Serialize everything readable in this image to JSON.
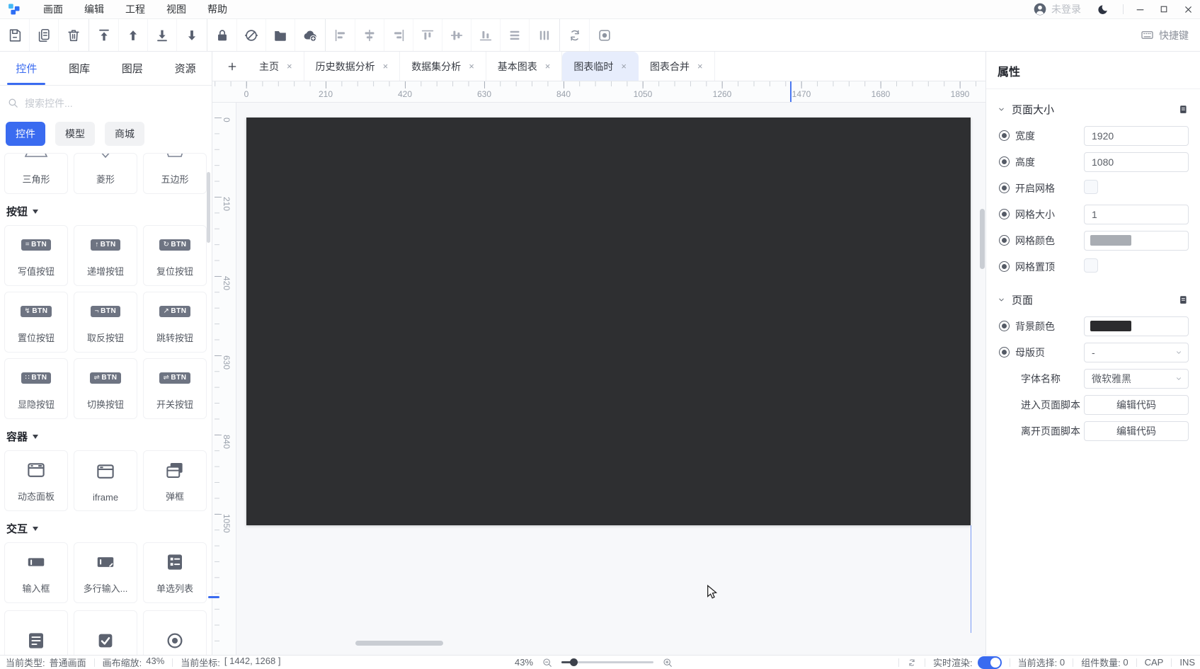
{
  "menubar": {
    "menus": [
      "画面",
      "编辑",
      "工程",
      "视图",
      "帮助"
    ],
    "user_label": "未登录"
  },
  "toolbar": {
    "groups": [
      {
        "tone": "dark",
        "icons": [
          "save",
          "copy",
          "trash"
        ]
      },
      {
        "tone": "dark",
        "icons": [
          "move-top",
          "move-up",
          "move-bottom",
          "move-down"
        ]
      },
      {
        "tone": "dark",
        "icons": [
          "lock",
          "hide",
          "folder",
          "cloud-add"
        ]
      },
      {
        "tone": "dim",
        "icons": [
          "align-left",
          "align-center-v",
          "align-right",
          "align-top",
          "align-center-h",
          "align-bottom",
          "distribute-v",
          "distribute-h"
        ]
      },
      {
        "tone": "mid",
        "icons": [
          "refresh",
          "record"
        ]
      }
    ],
    "shortcut_label": "快捷键"
  },
  "left_panel": {
    "tabs": [
      "控件",
      "图库",
      "图层",
      "资源"
    ],
    "active_tab": 0,
    "search_placeholder": "搜索控件...",
    "filters": [
      "控件",
      "模型",
      "商城"
    ],
    "active_filter": 0,
    "shapes": [
      {
        "label": "三角形",
        "shape": "triangle"
      },
      {
        "label": "菱形",
        "shape": "diamond"
      },
      {
        "label": "五边形",
        "shape": "pentagon"
      }
    ],
    "sections": [
      {
        "title": "按钮",
        "style": "badge",
        "badge_text": "BTN",
        "items": [
          {
            "label": "写值按钮",
            "glyph": "="
          },
          {
            "label": "递增按钮",
            "glyph": "↑"
          },
          {
            "label": "复位按钮",
            "glyph": "↻"
          },
          {
            "label": "置位按钮",
            "glyph": "↯"
          },
          {
            "label": "取反按钮",
            "glyph": "¬"
          },
          {
            "label": "跳转按钮",
            "glyph": "↗"
          },
          {
            "label": "显隐按钮",
            "glyph": "∷"
          },
          {
            "label": "切换按钮",
            "glyph": "⇌"
          },
          {
            "label": "开关按钮",
            "glyph": "⇌"
          }
        ]
      },
      {
        "title": "容器",
        "style": "icon",
        "items": [
          {
            "label": "动态面板",
            "icon": "panel"
          },
          {
            "label": "iframe",
            "icon": "iframe"
          },
          {
            "label": "弹框",
            "icon": "modal"
          }
        ]
      },
      {
        "title": "交互",
        "style": "icon",
        "items": [
          {
            "label": "输入框",
            "icon": "input"
          },
          {
            "label": "多行输入...",
            "icon": "textarea"
          },
          {
            "label": "单选列表",
            "icon": "radiolist"
          }
        ]
      }
    ],
    "partial_row_icons": [
      "droplist",
      "checkbox",
      "radio"
    ]
  },
  "page_tabs": {
    "tabs": [
      "主页",
      "历史数据分析",
      "数据集分析",
      "基本图表",
      "图表临时",
      "图表合并"
    ],
    "active_index": 4
  },
  "ruler": {
    "h_labels": [
      "0",
      "210",
      "420",
      "630",
      "840",
      "1050",
      "1260",
      "1470",
      "1680",
      "1890"
    ],
    "v_labels": [
      "0",
      "210",
      "420",
      "630",
      "840",
      "1050"
    ]
  },
  "properties": {
    "title": "属性",
    "sections": [
      {
        "title": "页面大小",
        "rows": [
          {
            "label": "宽度",
            "type": "input",
            "value": "1920",
            "icon": true
          },
          {
            "label": "高度",
            "type": "input",
            "value": "1080",
            "icon": true
          },
          {
            "label": "开启网格",
            "type": "checkbox",
            "checked": false,
            "icon": true
          },
          {
            "label": "网格大小",
            "type": "input",
            "value": "1",
            "icon": true
          },
          {
            "label": "网格颜色",
            "type": "color",
            "value": "#a9adb3",
            "icon": true
          },
          {
            "label": "网格置顶",
            "type": "checkbox",
            "checked": false,
            "icon": true
          }
        ]
      },
      {
        "title": "页面",
        "rows": [
          {
            "label": "背景颜色",
            "type": "color",
            "value": "#2b2b2d",
            "icon": true
          },
          {
            "label": "母版页",
            "type": "select",
            "value": "-",
            "icon": true
          },
          {
            "label": "字体名称",
            "type": "select",
            "value": "微软雅黑",
            "icon": false
          },
          {
            "label": "进入页面脚本",
            "type": "button",
            "value": "编辑代码",
            "icon": false
          },
          {
            "label": "离开页面脚本",
            "type": "button",
            "value": "编辑代码",
            "icon": false
          }
        ]
      }
    ]
  },
  "status_bar": {
    "left": [
      {
        "label": "当前类型:",
        "value": "普通画面"
      },
      {
        "label": "画布缩放:",
        "value": "43%"
      },
      {
        "label": "当前坐标:",
        "value": "[ 1442, 1268 ]"
      }
    ],
    "zoom_percent": "43%",
    "realtime_label": "实时渲染:",
    "realtime_on": true,
    "selection_label": "当前选择:",
    "selection_value": "0",
    "components_label": "组件数量:",
    "components_value": "0",
    "cap": "CAP",
    "ins": "INS"
  },
  "colors": {
    "accent": "#3a6bf0",
    "canvas_bg": "#2e2f31",
    "active_tab_bg": "#e7edfc"
  }
}
